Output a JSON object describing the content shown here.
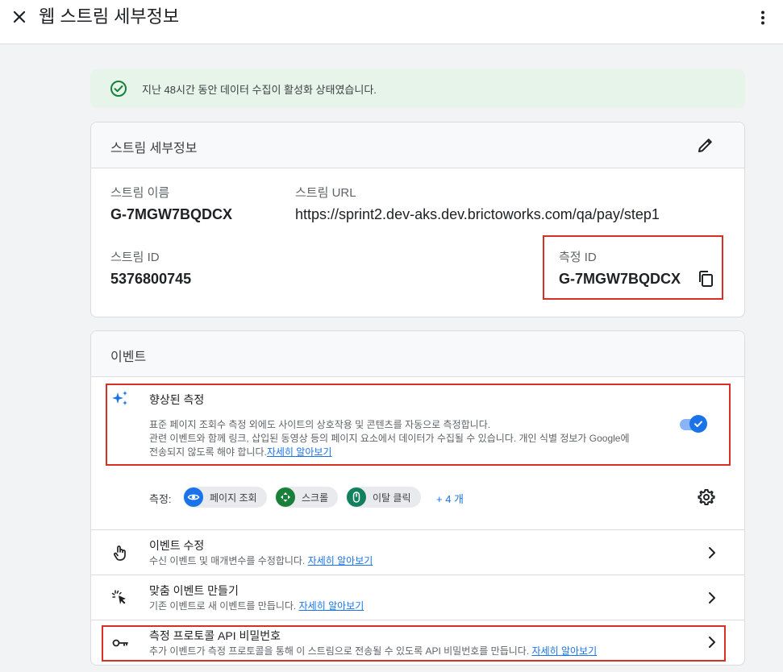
{
  "header": {
    "title": "웹 스트림 세부정보"
  },
  "banner": {
    "text": "지난 48시간 동안 데이터 수집이 활성화 상태였습니다."
  },
  "stream_details": {
    "title": "스트림 세부정보",
    "name_label": "스트림 이름",
    "name_value": "G-7MGW7BQDCX",
    "url_label": "스트림 URL",
    "url_value": "https://sprint2.dev-aks.dev.brictoworks.com/qa/pay/step1",
    "id_label": "스트림 ID",
    "id_value": "5376800745",
    "measurement_label": "측정 ID",
    "measurement_value": "G-7MGW7BQDCX"
  },
  "events": {
    "title": "이벤트",
    "enhanced": {
      "title": "향상된 측정",
      "desc_line1": "표준 페이지 조회수 측정 외에도 사이트의 상호작용 및 콘텐츠를 자동으로 측정합니다.",
      "desc_line2": "관련 이벤트와 함께 링크, 삽입된 동영상 등의 페이지 요소에서 데이터가 수집될 수 있습니다. 개인 식별 정보가 Google에",
      "desc_line3": "전송되지 않도록 해야 합니다.",
      "link": "자세히 알아보기",
      "enabled": true
    },
    "measuring_label": "측정:",
    "chips": [
      {
        "label": "페이지 조회",
        "icon": "eye-icon",
        "color": "#1a73e8"
      },
      {
        "label": "스크롤",
        "icon": "scroll-icon",
        "color": "#188038"
      },
      {
        "label": "이탈 클릭",
        "icon": "mouse-icon",
        "color": "#12805c"
      }
    ],
    "more_chips": "+ 4 개",
    "modify": {
      "title": "이벤트 수정",
      "desc": "수신 이벤트 및 매개변수를 수정합니다.",
      "link": "자세히 알아보기"
    },
    "create": {
      "title": "맞춤 이벤트 만들기",
      "desc": "기존 이벤트로 새 이벤트를 만듭니다.",
      "link": "자세히 알아보기"
    },
    "api_secret": {
      "title": "측정 프로토콜 API 비밀번호",
      "desc": "추가 이벤트가 측정 프로토콜을 통해 이 스트림으로 전송될 수 있도록 API 비밀번호를 만듭니다.",
      "link": "자세히 알아보기"
    }
  },
  "colors": {
    "accent": "#1a73e8",
    "highlight": "#d93025",
    "success_bg": "#e6f4ea",
    "success_icon": "#188038"
  }
}
